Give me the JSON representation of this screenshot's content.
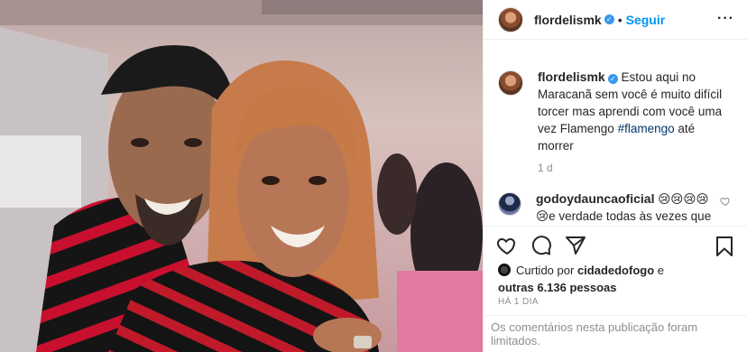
{
  "post": {
    "username": "flordelismk",
    "follow_label": "Seguir",
    "dot": "•",
    "verified_mark": "✓",
    "more_label": "···",
    "caption_text": "Estou aqui no Maracanã sem você é muito difícil torcer mas aprendi com você uma vez Flamengo",
    "caption_tag": "#flamengo",
    "caption_tail": "até morrer",
    "caption_age": "1 d"
  },
  "comment": {
    "username": "godoydauncaoficial",
    "emojis_1": "😢😢😢😢",
    "emoji_2": "😢",
    "text": "e verdade todas às vezes que vi foto de vcs eram juntos!"
  },
  "likes": {
    "prefix": "Curtido por",
    "user": "cidadedofogo",
    "joiner": "e",
    "others": "outras 6.136 pessoas"
  },
  "timestamp": "HÁ 1 DIA",
  "comments_limited": "Os comentários nesta publicação foram limitados.",
  "icons": {
    "like": "heart-icon",
    "comment": "comment-icon",
    "share": "share-icon",
    "save": "bookmark-icon"
  },
  "colors": {
    "link_blue": "#0095f6",
    "verified_blue": "#3897f0",
    "muted": "#8e8e8e",
    "flamengo_red": "#c8102e"
  }
}
